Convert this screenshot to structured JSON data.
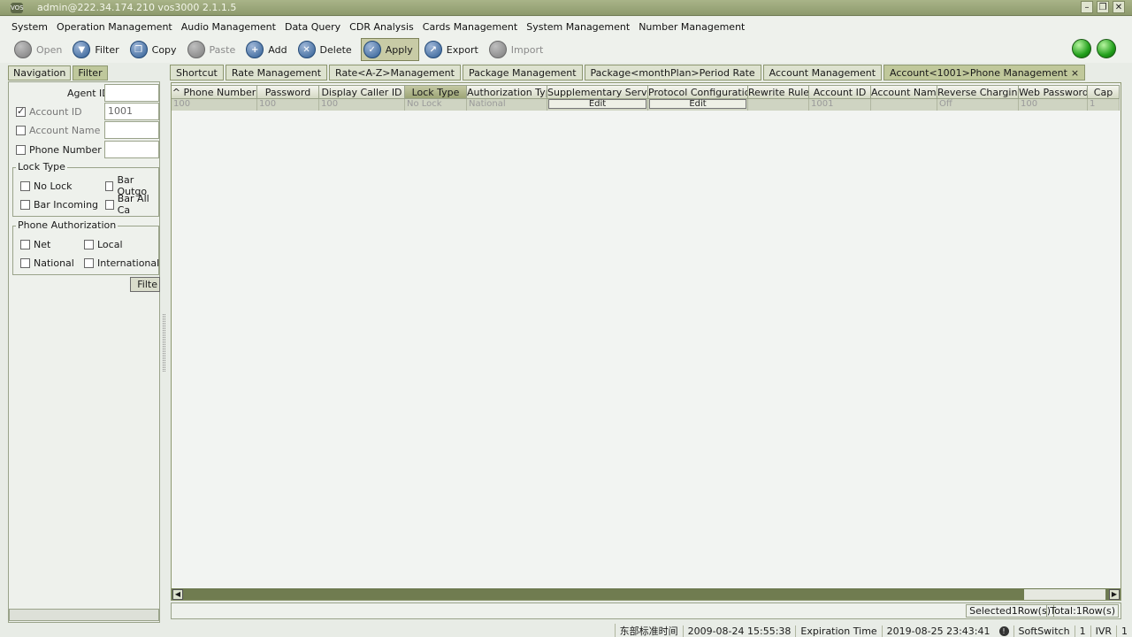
{
  "window": {
    "title": "admin@222.34.174.210 vos3000 2.1.1.5"
  },
  "menu": [
    "System",
    "Operation Management",
    "Audio Management",
    "Data Query",
    "CDR Analysis",
    "Cards Management",
    "System Management",
    "Number Management"
  ],
  "toolbar": {
    "open": "Open",
    "filter": "Filter",
    "copy": "Copy",
    "paste": "Paste",
    "add": "Add",
    "delete": "Delete",
    "apply": "Apply",
    "export": "Export",
    "import": "Import"
  },
  "left_tabs": {
    "navigation": "Navigation",
    "filter": "Filter"
  },
  "filter": {
    "agent_id_label": "Agent ID",
    "account_id_label": "Account ID",
    "account_id_value": "1001",
    "account_name_label": "Account Name",
    "phone_number_label": "Phone Number",
    "lock_type_legend": "Lock Type",
    "no_lock": "No Lock",
    "bar_outgoing": "Bar Outgo",
    "bar_incoming": "Bar Incoming",
    "bar_all": "Bar All Ca",
    "phone_auth_legend": "Phone Authorization",
    "net": "Net",
    "local": "Local",
    "national": "National",
    "international": "International",
    "filter_button": "Filte"
  },
  "tabs": [
    "Shortcut",
    "Rate Management",
    "Rate<A-Z>Management",
    "Package Management",
    "Package<monthPlan>Period Rate",
    "Account Management",
    "Account<1001>Phone Management"
  ],
  "tab_close": "×",
  "grid": {
    "sort_indicator": "^",
    "columns": [
      "Phone Number",
      "Password",
      "Display Caller ID",
      "Lock Type",
      "Authorization Type",
      "Supplementary Service",
      "Protocol Configuration",
      "Rewrite Rule",
      "Account ID",
      "Account Name",
      "Reverse Charging",
      "Web Password",
      "Cap"
    ],
    "rows": [
      [
        "100",
        "100",
        "100",
        "No Lock",
        "National",
        "Edit",
        "Edit",
        "",
        "1001",
        "",
        "Off",
        "100",
        "1"
      ]
    ]
  },
  "footer": {
    "selected": "Selected1Row(s)",
    "total": "Total:1Row(s)"
  },
  "statusbar": {
    "timezone": "东部标准时间",
    "time": "2009-08-24 15:55:38",
    "expiration_label": "Expiration Time",
    "expiration": "2019-08-25 23:43:41",
    "softswitch": "SoftSwitch",
    "softswitch_count": "1",
    "ivr": "IVR",
    "ivr_count": "1"
  },
  "colors": {
    "accent": "#8d9a6d",
    "active_tab": "#c0c89b",
    "status_green": "#22a01c"
  }
}
